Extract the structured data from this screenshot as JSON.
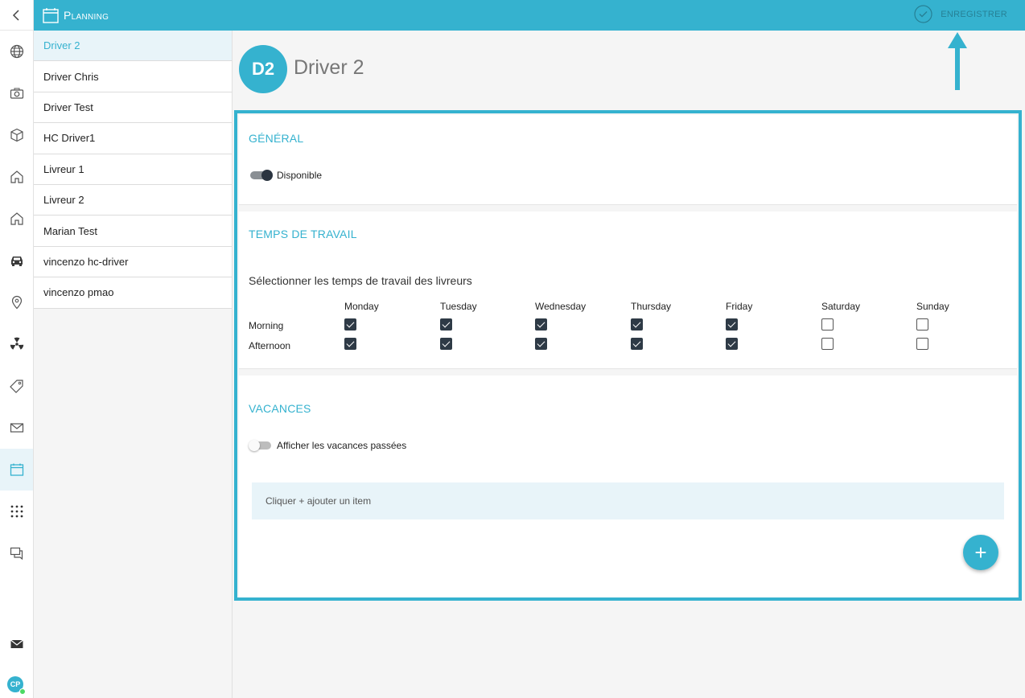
{
  "topbar": {
    "title": "Planning",
    "save_label": "ENREGISTRER"
  },
  "drivers": [
    {
      "label": "Driver 2",
      "active": true
    },
    {
      "label": "Driver Chris"
    },
    {
      "label": "Driver Test"
    },
    {
      "label": "HC Driver1"
    },
    {
      "label": "Livreur 1"
    },
    {
      "label": "Livreur 2"
    },
    {
      "label": "Marian Test"
    },
    {
      "label": "vincenzo hc-driver"
    },
    {
      "label": "vincenzo pmao"
    }
  ],
  "selected_driver": {
    "initials": "D2",
    "name": "Driver 2"
  },
  "general": {
    "title": "GÉNÉRAL",
    "toggle_label": "Disponible",
    "toggle_on": true
  },
  "work_time": {
    "title": "TEMPS DE TRAVAIL",
    "subtitle": "Sélectionner les temps de travail des livreurs",
    "days": [
      "Monday",
      "Tuesday",
      "Wednesday",
      "Thursday",
      "Friday",
      "Saturday",
      "Sunday"
    ],
    "rows": [
      {
        "label": "Morning",
        "checked": [
          true,
          true,
          true,
          true,
          true,
          false,
          false
        ]
      },
      {
        "label": "Afternoon",
        "checked": [
          true,
          true,
          true,
          true,
          true,
          false,
          false
        ]
      }
    ]
  },
  "vacations": {
    "title": "VACANCES",
    "toggle_label": "Afficher les vacances passées",
    "toggle_on": false,
    "empty_text": "Cliquer + ajouter un item",
    "add_label": "+"
  },
  "user": {
    "initials": "CP",
    "status_color": "#4cd964"
  },
  "colors": {
    "accent": "#35b2cf",
    "active_bg": "#e8f4f9",
    "checkbox": "#2e3a46"
  },
  "rail_icons": [
    "globe-icon",
    "camera-icon",
    "cube-icon",
    "home-icon",
    "building-icon",
    "car-icon",
    "location-pin-icon",
    "radiation-icon",
    "tag-icon",
    "mail-icon",
    "calendar-icon",
    "grid-icon",
    "chat-icon"
  ]
}
